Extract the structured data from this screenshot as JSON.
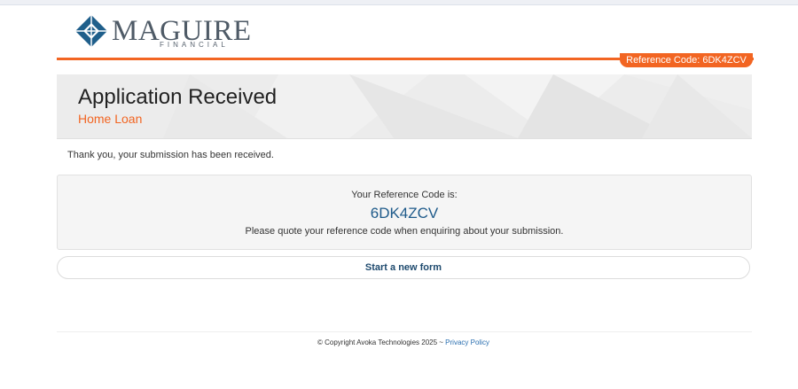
{
  "brand": {
    "name": "MAGUIRE",
    "sub": "FINANCIAL",
    "color": "#f26522"
  },
  "header": {
    "reference_tab": "Reference Code: 6DK4ZCV"
  },
  "banner": {
    "title": "Application Received",
    "subtitle": "Home Loan"
  },
  "main": {
    "thanks": "Thank you, your submission has been received.",
    "ref_label": "Your Reference Code is:",
    "ref_code": "6DK4ZCV",
    "ref_note": "Please quote your reference code when enquiring about your submission.",
    "new_form_button": "Start a new form"
  },
  "footer": {
    "copyright": "© Copyright Avoka Technologies 2025 ~",
    "privacy_link": "Privacy Policy"
  }
}
